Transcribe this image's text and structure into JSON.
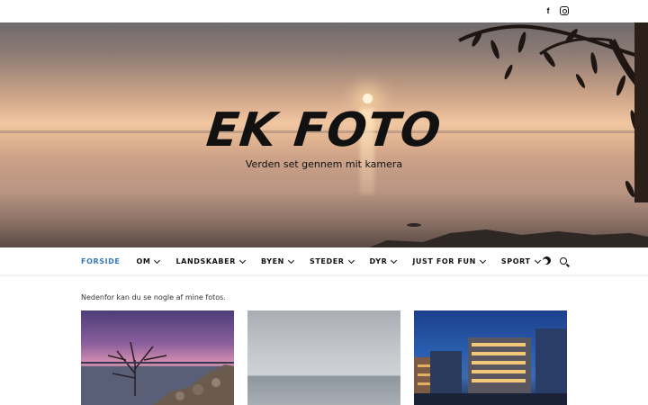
{
  "topbar": {
    "social": [
      {
        "icon": "facebook-icon",
        "glyph": "f"
      },
      {
        "icon": "instagram-icon",
        "glyph": ""
      }
    ]
  },
  "hero": {
    "title": "EK FOTO",
    "subtitle": "Verden set gennem mit kamera"
  },
  "nav": {
    "items": [
      {
        "label": "FORSIDE",
        "active": true,
        "dropdown": false
      },
      {
        "label": "OM",
        "active": false,
        "dropdown": true
      },
      {
        "label": "LANDSKABER",
        "active": false,
        "dropdown": true
      },
      {
        "label": "BYEN",
        "active": false,
        "dropdown": true
      },
      {
        "label": "STEDER",
        "active": false,
        "dropdown": true
      },
      {
        "label": "DYR",
        "active": false,
        "dropdown": true
      },
      {
        "label": "JUST FOR FUN",
        "active": false,
        "dropdown": true
      },
      {
        "label": "SPORT",
        "active": false,
        "dropdown": true
      }
    ],
    "tools": [
      "moon-icon",
      "search-icon"
    ],
    "active_color": "#3a78b5"
  },
  "main": {
    "intro": "Nedenfor kan du se nogle af mine fotos."
  }
}
